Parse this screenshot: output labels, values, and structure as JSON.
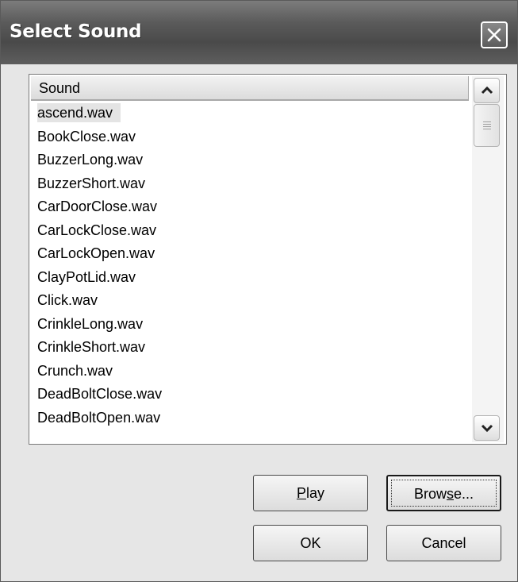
{
  "dialog": {
    "title": "Select Sound"
  },
  "list": {
    "header": "Sound",
    "selected_index": 0,
    "items": [
      "ascend.wav",
      "BookClose.wav",
      "BuzzerLong.wav",
      "BuzzerShort.wav",
      "CarDoorClose.wav",
      "CarLockClose.wav",
      "CarLockOpen.wav",
      "ClayPotLid.wav",
      "Click.wav",
      "CrinkleLong.wav",
      "CrinkleShort.wav",
      "Crunch.wav",
      "DeadBoltClose.wav",
      "DeadBoltOpen.wav"
    ]
  },
  "buttons": {
    "play": {
      "pre": "",
      "mnemonic": "P",
      "post": "lay"
    },
    "browse": {
      "pre": "Brow",
      "mnemonic": "s",
      "post": "e..."
    },
    "ok": "OK",
    "cancel": "Cancel"
  },
  "icons": {
    "close": "close-icon",
    "scroll_up": "chevron-up-icon",
    "scroll_down": "chevron-down-icon"
  }
}
